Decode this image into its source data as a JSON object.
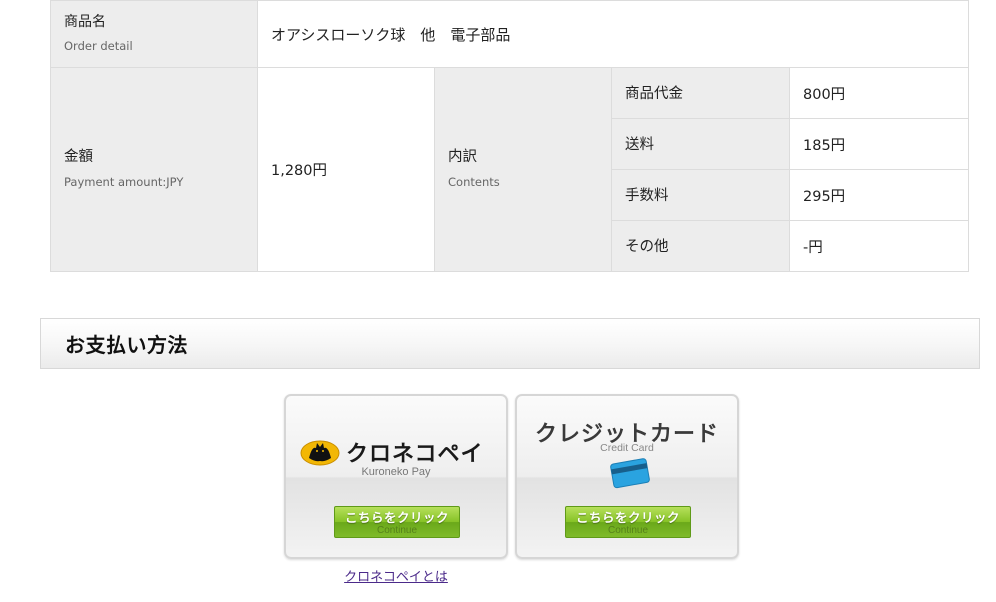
{
  "order": {
    "item_label_jp": "商品名",
    "item_label_en": "Order detail",
    "item_value": "オアシスローソク球　他　電子部品",
    "amount_label_jp": "金額",
    "amount_label_en": "Payment amount:JPY",
    "amount_value": "1,280円",
    "breakdown_label_jp": "内訳",
    "breakdown_label_en": "Contents",
    "breakdown": [
      {
        "label": "商品代金",
        "value": "800円"
      },
      {
        "label": "送料",
        "value": "185円"
      },
      {
        "label": "手数料",
        "value": "295円"
      },
      {
        "label": "その他",
        "value": "-円"
      }
    ]
  },
  "payment_section": {
    "title": "お支払い方法",
    "kuroneko": {
      "title": "クロネコペイ",
      "subtitle": "Kuroneko Pay",
      "button_jp": "こちらをクリック",
      "button_en": "Continue",
      "link": "クロネコペイとは",
      "logo_icon": "black-cat-icon"
    },
    "credit": {
      "title": "クレジットカード",
      "subtitle": "Credit Card",
      "button_jp": "こちらをクリック",
      "button_en": "Continue",
      "card_icon": "credit-card-icon"
    }
  },
  "colors": {
    "header_bg": "#ededed",
    "border": "#dcdcdc",
    "button_green": "#86c226",
    "card_blue": "#2aa3e0",
    "link": "#4b2a8a"
  }
}
